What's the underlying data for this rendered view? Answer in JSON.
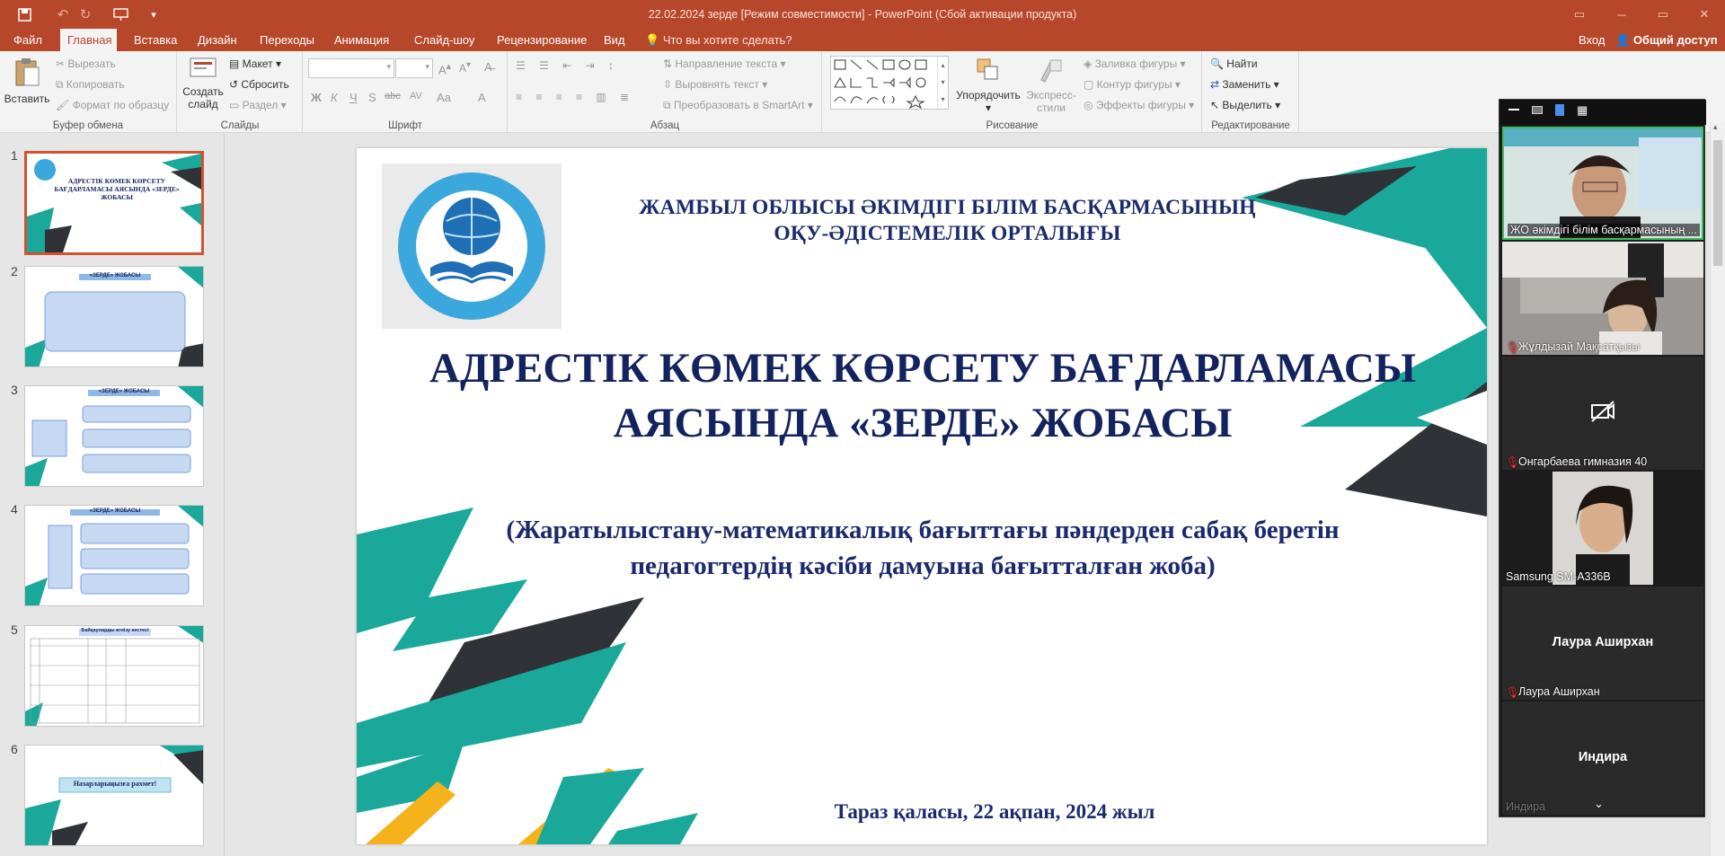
{
  "window": {
    "title": "22.02.2024 зерде [Режим совместимости] - PowerPoint (Сбой активации продукта)",
    "buttons": [
      "─",
      "▭",
      "✕"
    ]
  },
  "tabs": [
    "Файл",
    "Главная",
    "Вставка",
    "Дизайн",
    "Переходы",
    "Анимация",
    "Слайд-шоу",
    "Рецензирование",
    "Вид"
  ],
  "active_tab": "Главная",
  "tell_me": "Что вы хотите сделать?",
  "account": {
    "login": "Вход",
    "share": "Общий доступ"
  },
  "ribbon": {
    "clipboard": {
      "label": "Буфер обмена",
      "paste": "Вставить",
      "cut": "Вырезать",
      "copy": "Копировать",
      "format_painter": "Формат по образцу"
    },
    "slides": {
      "label": "Слайды",
      "new_slide": "Создать слайд",
      "layout": "Макет",
      "reset": "Сбросить",
      "section": "Раздел"
    },
    "font": {
      "label": "Шрифт",
      "name": "",
      "size": "",
      "styles": [
        "Ж",
        "К",
        "Ч",
        "S",
        "abc",
        "AV",
        "Aa",
        "A"
      ]
    },
    "paragraph": {
      "label": "Абзац",
      "text_direction": "Направление текста",
      "align_text": "Выровнять текст",
      "smartart": "Преобразовать в SmartArt"
    },
    "drawing": {
      "label": "Рисование",
      "arrange": "Упорядочить",
      "quick_styles": "Экспресс-стили",
      "fill": "Заливка фигуры",
      "outline": "Контур фигуры",
      "effects": "Эффекты фигуры"
    },
    "editing": {
      "label": "Редактирование",
      "find": "Найти",
      "replace": "Заменить",
      "select": "Выделить"
    }
  },
  "thumbnails": [
    {
      "num": "1",
      "title": "АДРЕСТІК КӨМЕК КӨРСЕТУ БАҒДАРЛАМАСЫ АЯСЫНДА «ЗЕРДЕ» ЖОБАСЫ",
      "selected": true
    },
    {
      "num": "2",
      "title": "«ЗЕРДЕ» ЖОБАСЫ",
      "selected": false
    },
    {
      "num": "3",
      "title": "«ЗЕРДЕ» ЖОБАСЫ",
      "selected": false
    },
    {
      "num": "4",
      "title": "«ЗЕРДЕ» ЖОБАСЫ",
      "selected": false
    },
    {
      "num": "5",
      "title": "Байқауларды өткізу кестесі",
      "selected": false
    },
    {
      "num": "6",
      "title": "Назарларыңызға рахмет!",
      "selected": false
    }
  ],
  "slide": {
    "org_line1": "ЖАМБЫЛ ОБЛЫСЫ ӘКІМДІГІ БІЛІМ БАСҚАРМАСЫНЫҢ",
    "org_line2": "ОҚУ-ӘДІСТЕМЕЛІК ОРТАЛЫҒЫ",
    "title_line1": "АДРЕСТІК КӨМЕК КӨРСЕТУ БАҒДАРЛАМАСЫ",
    "title_line2": "АЯСЫНДА «ЗЕРДЕ» ЖОБАСЫ",
    "subtitle_line1": "(Жаратылыстану-математикалық бағыттағы пәндерден сабақ беретін",
    "subtitle_line2": "педагогтердің кәсіби дамуына бағытталған жоба)",
    "footer": "Тараз қаласы,  22 ақпан, 2024 жыл"
  },
  "zoom": {
    "participants": [
      {
        "name": "ЖО әкімдігі білім басқармасының ...",
        "video": true,
        "muted": false
      },
      {
        "name": "Жұлдызай Мақсатқызы",
        "video": true,
        "muted": true
      },
      {
        "name": "Онгарбаева  гимназия 40",
        "video": false,
        "muted": true
      },
      {
        "name": "Samsung SM-A336B",
        "video": true,
        "muted": false
      },
      {
        "name": "Лаура Аширхан",
        "center": "Лаура Аширхан",
        "video": false,
        "muted": true
      },
      {
        "name": "Индира",
        "center": "Индира",
        "video": false,
        "muted": false
      }
    ]
  },
  "colors": {
    "accent": "#b7472a",
    "teal": "#1aa89a",
    "navy": "#13235f",
    "dark": "#2f3338",
    "yellow": "#f6b21a"
  }
}
